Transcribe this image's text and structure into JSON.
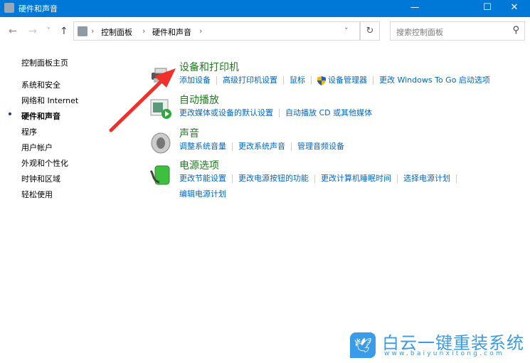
{
  "window": {
    "title": "硬件和声音",
    "minimize": "—",
    "maximize": "☐",
    "close": "✕"
  },
  "toolbar": {
    "back": "←",
    "forward": "→",
    "recent": "˅",
    "up": "↑",
    "breadcrumb": [
      "控制面板",
      "硬件和声音"
    ],
    "separator": "›",
    "dropdown": "˅",
    "refresh": "↻",
    "search_placeholder": "搜索控制面板",
    "search_icon": "⚲"
  },
  "sidebar": {
    "items": [
      {
        "label": "控制面板主页"
      },
      {
        "label": "系统和安全"
      },
      {
        "label": "网络和 Internet"
      },
      {
        "label": "硬件和声音",
        "active": true
      },
      {
        "label": "程序"
      },
      {
        "label": "用户帐户"
      },
      {
        "label": "外观和个性化"
      },
      {
        "label": "时钟和区域"
      },
      {
        "label": "轻松使用"
      }
    ]
  },
  "categories": [
    {
      "title": "设备和打印机",
      "icon": "printer-icon",
      "links": [
        "添加设备",
        "高级打印机设置",
        "鼠标",
        "设备管理器",
        "更改 Windows To Go 启动选项"
      ]
    },
    {
      "title": "自动播放",
      "icon": "autoplay-icon",
      "links": [
        "更改媒体或设备的默认设置",
        "自动播放 CD 或其他媒体"
      ]
    },
    {
      "title": "声音",
      "icon": "speaker-icon",
      "links": [
        "调整系统音量",
        "更改系统声音",
        "管理音频设备"
      ]
    },
    {
      "title": "电源选项",
      "icon": "battery-icon",
      "links": [
        "更改节能设置",
        "更改电源按钮的功能",
        "更改计算机睡眠时间",
        "选择电源计划",
        "编辑电源计划"
      ]
    }
  ],
  "watermark": {
    "name": "白云一键重装系统",
    "url": "www.baiyunxitong.com"
  },
  "colors": {
    "titlebar": "#0078d7",
    "link": "#0066cc",
    "heading": "#1e7b1e",
    "arrow": "#f0302a"
  }
}
